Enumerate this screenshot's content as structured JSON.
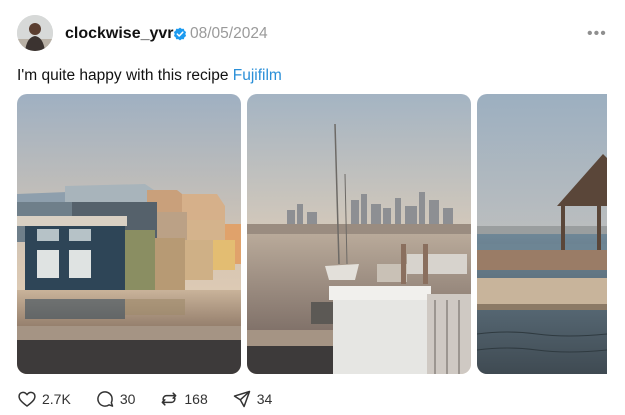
{
  "post": {
    "author": {
      "username": "clockwise_yvr",
      "verified": true,
      "avatar_icon": "avatar-photo"
    },
    "date": "08/05/2024",
    "more_menu_icon": "more-dots-icon",
    "text": "I'm quite happy with this recipe ",
    "tag": "Fujifilm",
    "images": [
      {
        "subject": "houseboats-at-golden-hour"
      },
      {
        "subject": "marina-with-city-skyline"
      },
      {
        "subject": "pier-with-gazebo"
      }
    ],
    "actions": {
      "likes": "2.7K",
      "replies": "30",
      "reposts": "168",
      "shares": "34"
    }
  },
  "colors": {
    "text": "#111111",
    "muted": "#9a9a9a",
    "link": "#2a8fd8",
    "verified": "#1d9bf0"
  }
}
